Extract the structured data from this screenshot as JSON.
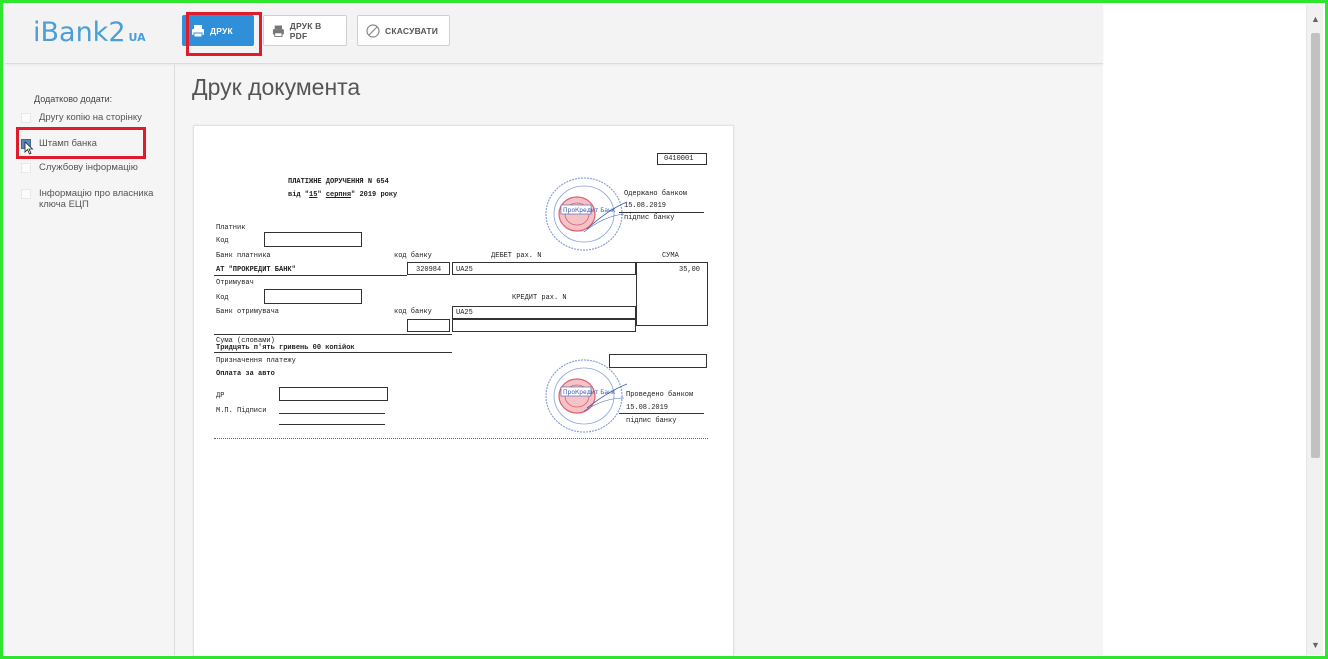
{
  "app": {
    "logo": "iBank2",
    "logo_suffix": "UA"
  },
  "toolbar": {
    "print_label": "ДРУК",
    "pdf_label": "ДРУК В PDF",
    "cancel_label": "СКАСУВАТИ"
  },
  "sidebar": {
    "title": "Додатково додати:",
    "options": [
      {
        "label": "Другу копію на сторінку",
        "checked": false
      },
      {
        "label": "Штамп банка",
        "checked": true
      },
      {
        "label": "Службову інформацію",
        "checked": false
      },
      {
        "label": "Інформацію про власника ключа ЕЦП",
        "checked": false
      }
    ]
  },
  "main": {
    "heading": "Друк документа"
  },
  "document": {
    "form_code": "0410001",
    "title": "ПЛАТІЖНЕ ДОРУЧЕННЯ N 654",
    "date_prefix": "від \"",
    "date_day": "15",
    "date_month": "серпня",
    "date_suffix": "\" 2019 року",
    "date_line_mid": "\"",
    "payer_label": "Платник",
    "code_label": "Код",
    "payer_bank_label": "Банк платника",
    "bank_code_label": "код банку",
    "debit_label": "ДЕБЕТ рах. N",
    "sum_label": "СУМА",
    "payer_bank_name": "АТ \"ПРОКРЕДИТ БАНК\"",
    "payer_bank_code": "320984",
    "debit_account": "UA25",
    "amount": "35,00",
    "recipient_label": "Отримувач",
    "credit_label": "КРЕДИТ рах. N",
    "recipient_bank_label": "Банк отримувача",
    "credit_account": "UA25",
    "sum_words_label": "Сума (словами)",
    "sum_words": "Тридцять п'ять гривень 00 копійок",
    "purpose_label": "Призначення платежу",
    "purpose": "Оплата за авто",
    "dp_label": "ДР",
    "signatures_label": "М.П.  Підписи",
    "stamp1_line1": "Одержано банком",
    "stamp1_date": "15.08.2019",
    "stamp1_line3": "підпис банку",
    "stamp2_line1": "Проведено банком",
    "stamp2_date": "15.08.2019",
    "stamp2_line3": "підпис банку",
    "seal_text": "ПроКредит Банк"
  },
  "colors": {
    "accent": "#2f8fd9",
    "highlight": "#e01b2b",
    "frame": "#2ee62e",
    "logo": "#4a9fd6"
  }
}
